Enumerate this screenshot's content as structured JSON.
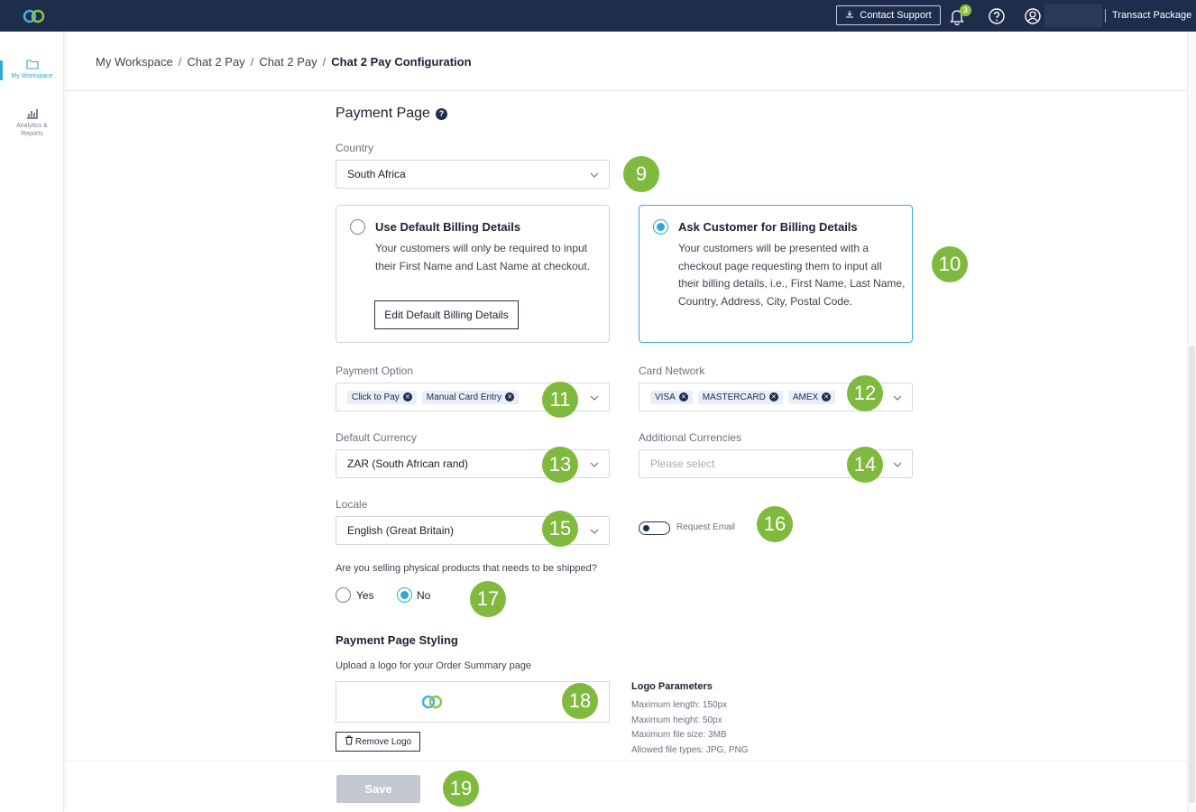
{
  "header": {
    "contact_label": "Contact Support",
    "notification_count": "3",
    "package_label": "Transact Package"
  },
  "sidebar": {
    "items": [
      {
        "label": "My Workspace",
        "icon": "folder-icon",
        "active": true
      },
      {
        "label": "Analytics & Reports",
        "icon": "analytics-icon",
        "active": false
      }
    ]
  },
  "breadcrumb": [
    "My Workspace",
    "Chat 2 Pay",
    "Chat 2 Pay",
    "Chat 2 Pay Configuration"
  ],
  "payment_page": {
    "title": "Payment Page",
    "help": "?",
    "country_label": "Country",
    "country_value": "South Africa",
    "default_billing": {
      "title": "Use Default Billing Details",
      "desc": "Your customers will only be required to input their First Name and Last Name at checkout.",
      "button": "Edit Default Billing Details"
    },
    "ask_billing": {
      "title": "Ask Customer for Billing Details",
      "desc": "Your customers will be presented with a checkout page requesting them to input all their billing details, i.e., First Name, Last Name, Country, Address, City, Postal Code."
    },
    "payment_option_label": "Payment Option",
    "payment_options": [
      "Click to Pay",
      "Manual Card Entry"
    ],
    "card_network_label": "Card Network",
    "card_networks": [
      "VISA",
      "MASTERCARD",
      "AMEX"
    ],
    "default_currency_label": "Default Currency",
    "default_currency_value": "ZAR (South African rand)",
    "additional_currencies_label": "Additional Currencies",
    "additional_currencies_placeholder": "Please select",
    "locale_label": "Locale",
    "locale_value": "English (Great Britain)",
    "request_email_label": "Request Email",
    "physical_question": "Are you selling physical products that needs to be shipped?",
    "yes_label": "Yes",
    "no_label": "No"
  },
  "styling": {
    "title": "Payment Page Styling",
    "upload_text": "Upload a logo for your Order Summary page",
    "remove_label": "Remove Logo",
    "params_title": "Logo Parameters",
    "params": [
      "Maximum length: 150px",
      "Maximum height: 50px",
      "Maximum file size: 3MB",
      "Allowed file types: JPG, PNG"
    ]
  },
  "save_label": "Save",
  "callouts": [
    "9",
    "10",
    "11",
    "12",
    "13",
    "14",
    "15",
    "16",
    "17",
    "18",
    "19"
  ],
  "colors": {
    "topbar": "#1f2d4d",
    "accent": "#2fa8d7",
    "callout": "#7fb93d"
  }
}
